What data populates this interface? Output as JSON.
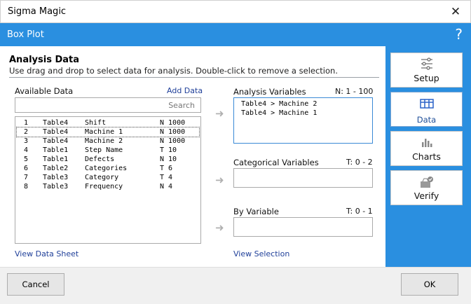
{
  "window": {
    "title": "Sigma Magic",
    "close_glyph": "✕"
  },
  "header": {
    "title": "Box Plot",
    "help_glyph": "?"
  },
  "section": {
    "title": "Analysis Data",
    "description": "Use drag and drop to select data for analysis. Double-click to remove a selection."
  },
  "available": {
    "label": "Available Data",
    "add_link": "Add Data",
    "search_placeholder": "Search",
    "rows": [
      {
        "num": "1",
        "table": "Table4",
        "name": "Shift",
        "info": "N 1000"
      },
      {
        "num": "2",
        "table": "Table4",
        "name": "Machine 1",
        "info": "N 1000"
      },
      {
        "num": "3",
        "table": "Table4",
        "name": "Machine 2",
        "info": "N 1000"
      },
      {
        "num": "4",
        "table": "Table1",
        "name": "Step Name",
        "info": "T 10"
      },
      {
        "num": "5",
        "table": "Table1",
        "name": "Defects",
        "info": "N 10"
      },
      {
        "num": "6",
        "table": "Table2",
        "name": "Categories",
        "info": "T 6"
      },
      {
        "num": "7",
        "table": "Table3",
        "name": "Category",
        "info": "T 4"
      },
      {
        "num": "8",
        "table": "Table3",
        "name": "Frequency",
        "info": "N 4"
      }
    ],
    "selected_index": 1,
    "view_sheet_link": "View Data Sheet"
  },
  "analysis_vars": {
    "label": "Analysis Variables",
    "range": "N: 1 - 100",
    "items": [
      "Table4 > Machine 2",
      "Table4 > Machine 1"
    ]
  },
  "categorical_vars": {
    "label": "Categorical Variables",
    "range": "T: 0 - 2"
  },
  "by_var": {
    "label": "By Variable",
    "range": "T: 0 - 1"
  },
  "view_selection_link": "View Selection",
  "sidebar": {
    "items": [
      {
        "label": "Setup",
        "icon": "sliders-icon"
      },
      {
        "label": "Data",
        "icon": "table-icon"
      },
      {
        "label": "Charts",
        "icon": "bar-chart-icon"
      },
      {
        "label": "Verify",
        "icon": "verify-icon"
      }
    ],
    "active_index": 1
  },
  "buttons": {
    "cancel": "Cancel",
    "ok": "OK"
  },
  "colors": {
    "accent": "#2a8fe0",
    "link": "#1f3f99"
  }
}
